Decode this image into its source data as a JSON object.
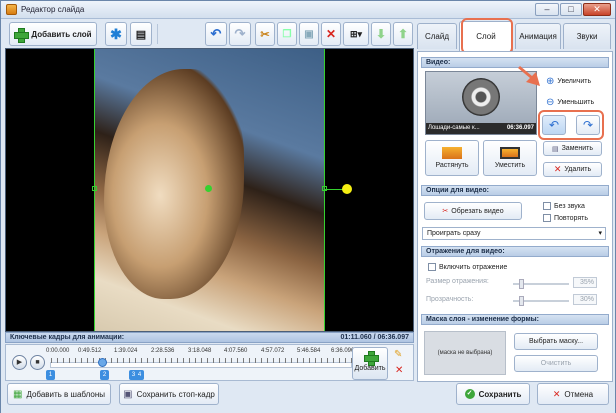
{
  "window": {
    "title": "Редактор слайда",
    "minimize": "–",
    "restore": "□",
    "close": "✕"
  },
  "toolbar": {
    "add_layer": "Добавить слой"
  },
  "tabs": [
    {
      "label": "Слайд"
    },
    {
      "label": "Слой"
    },
    {
      "label": "Анимация"
    },
    {
      "label": "Звуки"
    }
  ],
  "video_section": {
    "title": "Видео:",
    "thumb_name": "Лошади-самые к...",
    "thumb_duration": "06:36.097",
    "zoom_in": "Увеличить",
    "zoom_out": "Уменьшить",
    "replace": "Заменить",
    "delete": "Удалить",
    "stretch": "Растянуть",
    "fit": "Уместить"
  },
  "options": {
    "title": "Опции для видео:",
    "trim": "Обрезать видео",
    "mute": "Без звука",
    "repeat": "Повторять",
    "play_mode": "Проиграть сразу"
  },
  "reflection": {
    "title": "Отражение для видео:",
    "enable": "Включить отражение",
    "size_label": "Размер отражения:",
    "size_value": "35%",
    "transparency_label": "Прозрачность:",
    "transparency_value": "30%"
  },
  "mask": {
    "title": "Маска слоя - изменение формы:",
    "not_selected": "(маска не выбрана)",
    "choose": "Выбрать маску...",
    "clear": "Очистить"
  },
  "keyframes": {
    "title": "Ключевые кадры для анимации:",
    "time": "01:11.060 / 06:36.097",
    "ticks": [
      "0:00.000",
      "0:49.512",
      "1:39.024",
      "2:28.536",
      "3:18.048",
      "4:07.560",
      "4:57.072",
      "5:46.584",
      "6:36.096"
    ],
    "keys": [
      "1",
      "2",
      "3",
      "4"
    ],
    "add": "Добавить"
  },
  "bottom": {
    "add_templates": "Добавить в шаблоны",
    "save_frame": "Сохранить стоп-кадр",
    "save": "Сохранить",
    "cancel": "Отмена"
  },
  "colors": {
    "accent": "#e8704f",
    "green": "#35d12f",
    "yellow": "#f5ef12"
  }
}
